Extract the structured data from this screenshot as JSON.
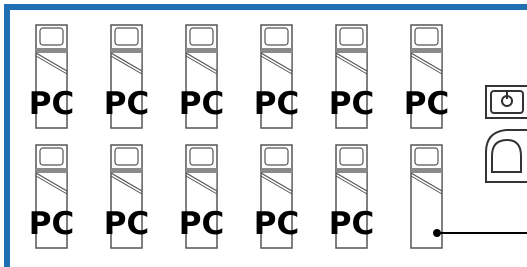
{
  "colors": {
    "wall": "#1f6fb2",
    "bed_outline": "#555555",
    "sheet": "#8a8a8a",
    "fixture": "#333333"
  },
  "beds": [
    {
      "label": "PC"
    },
    {
      "label": "PC"
    },
    {
      "label": "PC"
    },
    {
      "label": "PC"
    },
    {
      "label": "PC"
    },
    {
      "label": "PC"
    },
    {
      "label": "PC"
    },
    {
      "label": "PC"
    },
    {
      "label": "PC"
    },
    {
      "label": "PC"
    },
    {
      "label": "PC"
    },
    {
      "label": ""
    }
  ],
  "icons": {
    "sink": "sink-icon",
    "toilet": "toilet-icon",
    "pointer": "pointer-dot-icon"
  }
}
